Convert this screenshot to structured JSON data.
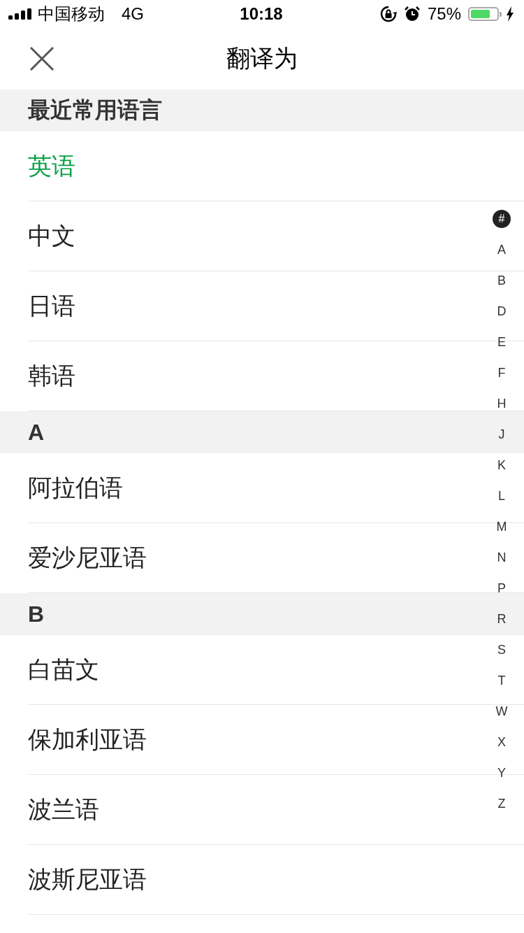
{
  "status_bar": {
    "carrier": "中国移动",
    "network": "4G",
    "time": "10:18",
    "battery_percent": "75%"
  },
  "nav_bar": {
    "title": "翻译为"
  },
  "sections": [
    {
      "header": "最近常用语言",
      "items": [
        {
          "label": "英语",
          "selected": true
        },
        {
          "label": "中文",
          "selected": false
        },
        {
          "label": "日语",
          "selected": false
        },
        {
          "label": "韩语",
          "selected": false
        }
      ]
    },
    {
      "header": "A",
      "items": [
        {
          "label": "阿拉伯语",
          "selected": false
        },
        {
          "label": "爱沙尼亚语",
          "selected": false
        }
      ]
    },
    {
      "header": "B",
      "items": [
        {
          "label": "白苗文",
          "selected": false
        },
        {
          "label": "保加利亚语",
          "selected": false
        },
        {
          "label": "波兰语",
          "selected": false
        },
        {
          "label": "波斯尼亚语",
          "selected": false
        }
      ]
    }
  ],
  "index_bar": [
    {
      "label": "#",
      "selected": true
    },
    {
      "label": "A",
      "selected": false
    },
    {
      "label": "B",
      "selected": false
    },
    {
      "label": "D",
      "selected": false
    },
    {
      "label": "E",
      "selected": false
    },
    {
      "label": "F",
      "selected": false
    },
    {
      "label": "H",
      "selected": false
    },
    {
      "label": "J",
      "selected": false
    },
    {
      "label": "K",
      "selected": false
    },
    {
      "label": "L",
      "selected": false
    },
    {
      "label": "M",
      "selected": false
    },
    {
      "label": "N",
      "selected": false
    },
    {
      "label": "P",
      "selected": false
    },
    {
      "label": "R",
      "selected": false
    },
    {
      "label": "S",
      "selected": false
    },
    {
      "label": "T",
      "selected": false
    },
    {
      "label": "W",
      "selected": false
    },
    {
      "label": "X",
      "selected": false
    },
    {
      "label": "Y",
      "selected": false
    },
    {
      "label": "Z",
      "selected": false
    }
  ]
}
